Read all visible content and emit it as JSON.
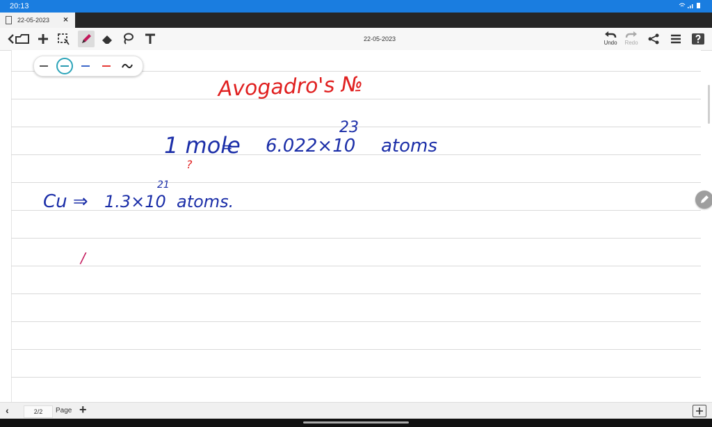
{
  "status_bar": {
    "time": "20:13",
    "icons": "wifi-icon signal-icon battery-icon"
  },
  "tab": {
    "label": "22-05-2023",
    "close": "×"
  },
  "toolbar": {
    "title": "22-05-2023",
    "undo_label": "Undo",
    "redo_label": "Redo",
    "tools": [
      "back-icon",
      "library-icon",
      "add-icon",
      "selection-icon",
      "pen-icon",
      "eraser-icon",
      "lasso-icon",
      "text-icon"
    ],
    "right_tools": [
      "undo-icon",
      "redo-icon",
      "share-icon",
      "menu-icon",
      "help-icon"
    ]
  },
  "pen_palette": {
    "colors": [
      "#555555",
      "#2a9ab0",
      "#3b66c9",
      "#e53935"
    ],
    "selected_index": 1
  },
  "ink": {
    "title": "Avogadro's №",
    "mole_line": {
      "lhs": "1 mole",
      "eq": "=",
      "value": "6.022×10",
      "exponent": "23",
      "unit": "atoms",
      "question": "?"
    },
    "cu_line": {
      "text": "Cu ⇒",
      "value": "1.3×10",
      "exponent": "21",
      "unit": "atoms."
    },
    "stray_mark": "/"
  },
  "bottom_bar": {
    "page_count": "2/2",
    "page_label": "Page",
    "add": "+"
  }
}
